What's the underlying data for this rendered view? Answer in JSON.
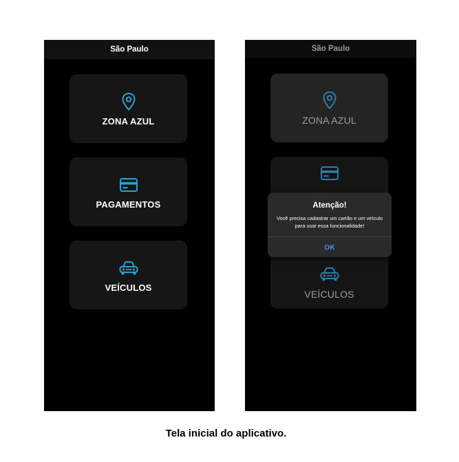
{
  "left_screen": {
    "city": "São Paulo",
    "menu": [
      {
        "label": "ZONA AZUL",
        "icon": "location-pin-icon"
      },
      {
        "label": "PAGAMENTOS",
        "icon": "credit-card-icon"
      },
      {
        "label": "VEÍCULOS",
        "icon": "car-icon"
      }
    ]
  },
  "right_screen": {
    "city": "São Paulo",
    "menu": [
      {
        "label": "ZONA AZUL",
        "icon": "location-pin-icon"
      },
      {
        "label": "",
        "icon": "credit-card-icon"
      },
      {
        "label": "VEÍCULOS",
        "icon": "car-icon"
      }
    ],
    "dialog": {
      "title": "Atenção!",
      "message": "Você precisa cadastrar um cartão e um veículo para usar essa funcionalidade!",
      "ok_label": "OK"
    }
  },
  "caption": "Tela inicial do aplicativo.",
  "colors": {
    "accent_icon": "#2f9fd6",
    "ok_button": "#4a8ef0",
    "card_bg": "#161616"
  }
}
